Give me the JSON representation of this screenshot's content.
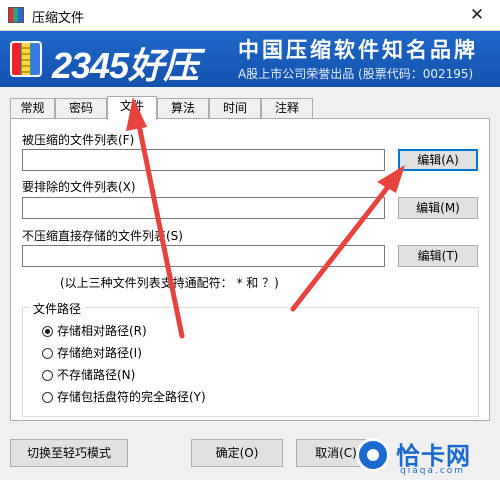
{
  "window": {
    "title": "压缩文件",
    "close_glyph": "✕"
  },
  "banner": {
    "brand": "2345好压",
    "slogan": "中国压缩软件知名品牌",
    "subslogan": "A股上市公司荣誉出品 (股票代码：002195)"
  },
  "tabs": [
    {
      "label": "常规"
    },
    {
      "label": "密码"
    },
    {
      "label": "文件"
    },
    {
      "label": "算法"
    },
    {
      "label": "时间"
    },
    {
      "label": "注释"
    }
  ],
  "active_tab": "文件",
  "files": {
    "compress_label": "被压缩的文件列表(F)",
    "compress_value": "",
    "compress_button": "编辑(A)",
    "exclude_label": "要排除的文件列表(X)",
    "exclude_value": "",
    "exclude_button": "编辑(M)",
    "store_label": "不压缩直接存储的文件列表(S)",
    "store_value": "",
    "store_button": "编辑(T)",
    "hint": "(以上三种文件列表支持通配符： * 和 ？)"
  },
  "path_group": {
    "title": "文件路径",
    "options": [
      {
        "label": "存储相对路径(R)",
        "checked": true
      },
      {
        "label": "存储绝对路径(I)",
        "checked": false
      },
      {
        "label": "不存储路径(N)",
        "checked": false
      },
      {
        "label": "存储包括盘符的完全路径(Y)",
        "checked": false
      }
    ]
  },
  "footer": {
    "simple_mode_button": "切换至轻巧模式",
    "ok_button": "确定(O)",
    "cancel_button": "取消(C)"
  },
  "watermark": {
    "text": "恰卡网",
    "sub": "qiaqa.com"
  },
  "colors": {
    "banner": "#1f68c9",
    "annotation_arrow": "#e8423f",
    "focus": "#0078d7"
  }
}
